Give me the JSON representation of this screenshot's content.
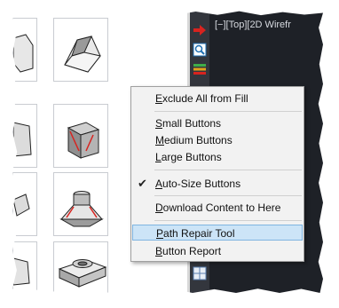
{
  "viewport": {
    "label": "[−][Top][2D Wirefr"
  },
  "menu": {
    "items": [
      {
        "mnemonic": "E",
        "rest": "xclude All from Fill"
      },
      {
        "mnemonic": "S",
        "rest": "mall Buttons"
      },
      {
        "mnemonic": "M",
        "rest": "edium Buttons"
      },
      {
        "mnemonic": "L",
        "rest": "arge Buttons"
      },
      {
        "mnemonic": "A",
        "rest": "uto-Size Buttons",
        "checked": true
      },
      {
        "mnemonic": "D",
        "rest": "ownload Content to Here"
      },
      {
        "mnemonic": "P",
        "rest": "ath Repair Tool",
        "highlighted": true
      },
      {
        "mnemonic": "B",
        "rest": "utton Report"
      }
    ],
    "check_glyph": "✔"
  },
  "toolstrip": {
    "icons": [
      "red-arrow-icon",
      "zoom-icon",
      "layers-icon",
      "grid-icon"
    ]
  },
  "colors": {
    "viewport_bg": "#1e2127",
    "menu_bg": "#f2f2f2",
    "menu_highlight": "#cce4f7",
    "accent_red": "#d8231f"
  }
}
